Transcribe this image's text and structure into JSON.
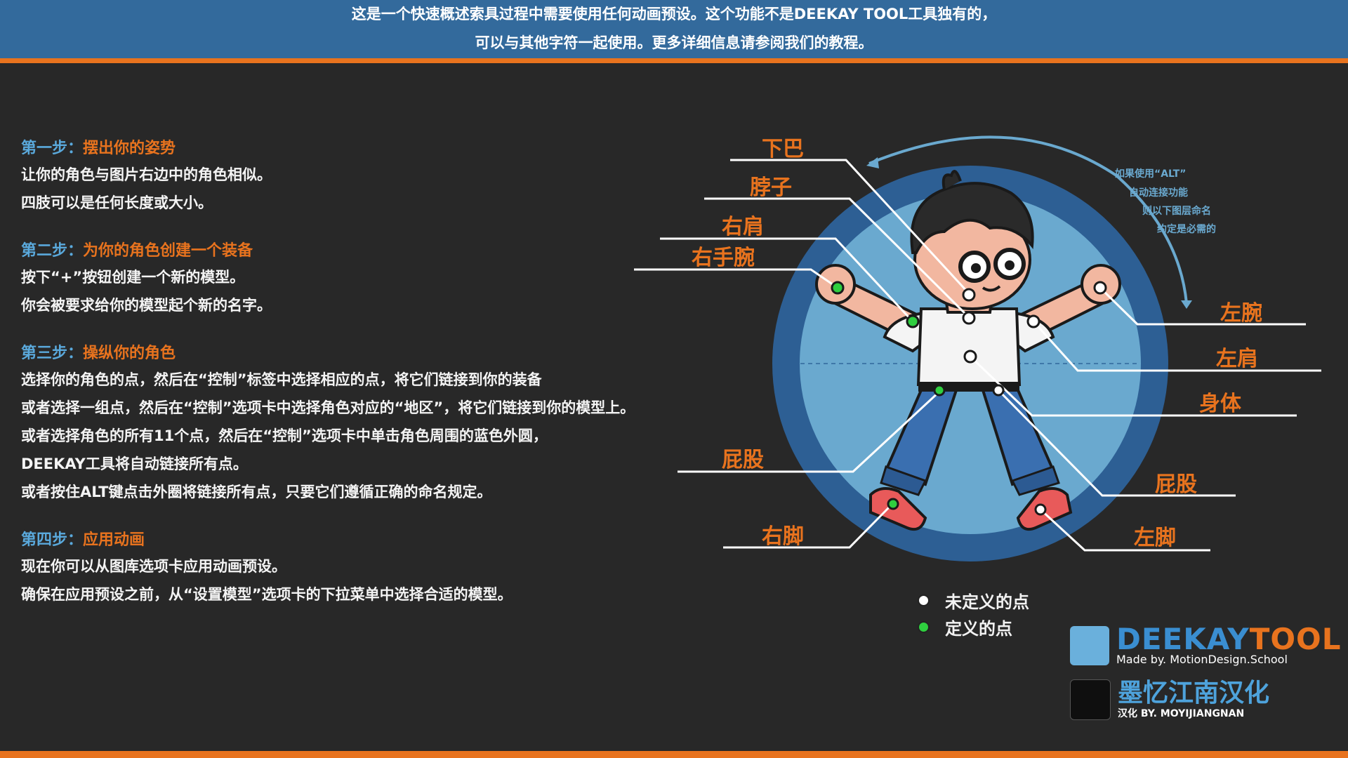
{
  "banner": {
    "line1": "这是一个快速概述索具过程中需要使用任何动画预设。这个功能不是DEEKAY TOOL工具独有的，",
    "line2": "可以与其他字符一起使用。更多详细信息请参阅我们的教程。"
  },
  "steps": [
    {
      "num": "第一步：",
      "title": "摆出你的姿势",
      "lines": [
        "让你的角色与图片右边中的角色相似。",
        "四肢可以是任何长度或大小。"
      ]
    },
    {
      "num": "第二步：",
      "title": "为你的角色创建一个装备",
      "lines": [
        "按下“+”按钮创建一个新的模型。",
        "你会被要求给你的模型起个新的名字。"
      ]
    },
    {
      "num": "第三步：",
      "title": "操纵你的角色",
      "lines": [
        "选择你的角色的点，然后在“控制”标签中选择相应的点，将它们链接到你的装备",
        "或者选择一组点，然后在“控制”选项卡中选择角色对应的“地区”，将它们链接到你的模型上。",
        "或者选择角色的所有11个点，然后在“控制”选项卡中单击角色周围的蓝色外圆，",
        "DEEKAY工具将自动链接所有点。",
        "或者按住ALT键点击外圈将链接所有点，只要它们遵循正确的命名规定。"
      ]
    },
    {
      "num": "第四步：",
      "title": "应用动画",
      "lines": [
        "现在你可以从图库选项卡应用动画预设。",
        "确保在应用预设之前，从“设置模型”选项卡的下拉菜单中选择合适的模型。"
      ]
    }
  ],
  "labels": {
    "chin": "下巴",
    "neck": "脖子",
    "right_shoulder": "右肩",
    "right_wrist": "右手腕",
    "right_hip": "屁股",
    "right_foot": "右脚",
    "left_wrist": "左腕",
    "left_shoulder": "左肩",
    "body": "身体",
    "left_hip": "屁股",
    "left_foot": "左脚"
  },
  "alt_note": [
    "如果使用“ALT”",
    "自动连接功能",
    "则以下图层命名",
    "约定是必需的"
  ],
  "legend": {
    "undefined": "未定义的点",
    "defined": "定义的点"
  },
  "logo": {
    "brand_part1": "DEEKAY",
    "brand_part2": "TOOL",
    "made_by": "Made by. MotionDesign.School",
    "cn_brand": "墨忆江南汉化",
    "cn_sub": "汉化 BY. MOYIJIANGNAN"
  },
  "colors": {
    "accent_orange": "#e8731e",
    "step_blue": "#5aa9dc",
    "banner_blue": "#336a9c",
    "defined_point": "#2fcf3f",
    "undefined_point": "#ffffff"
  }
}
